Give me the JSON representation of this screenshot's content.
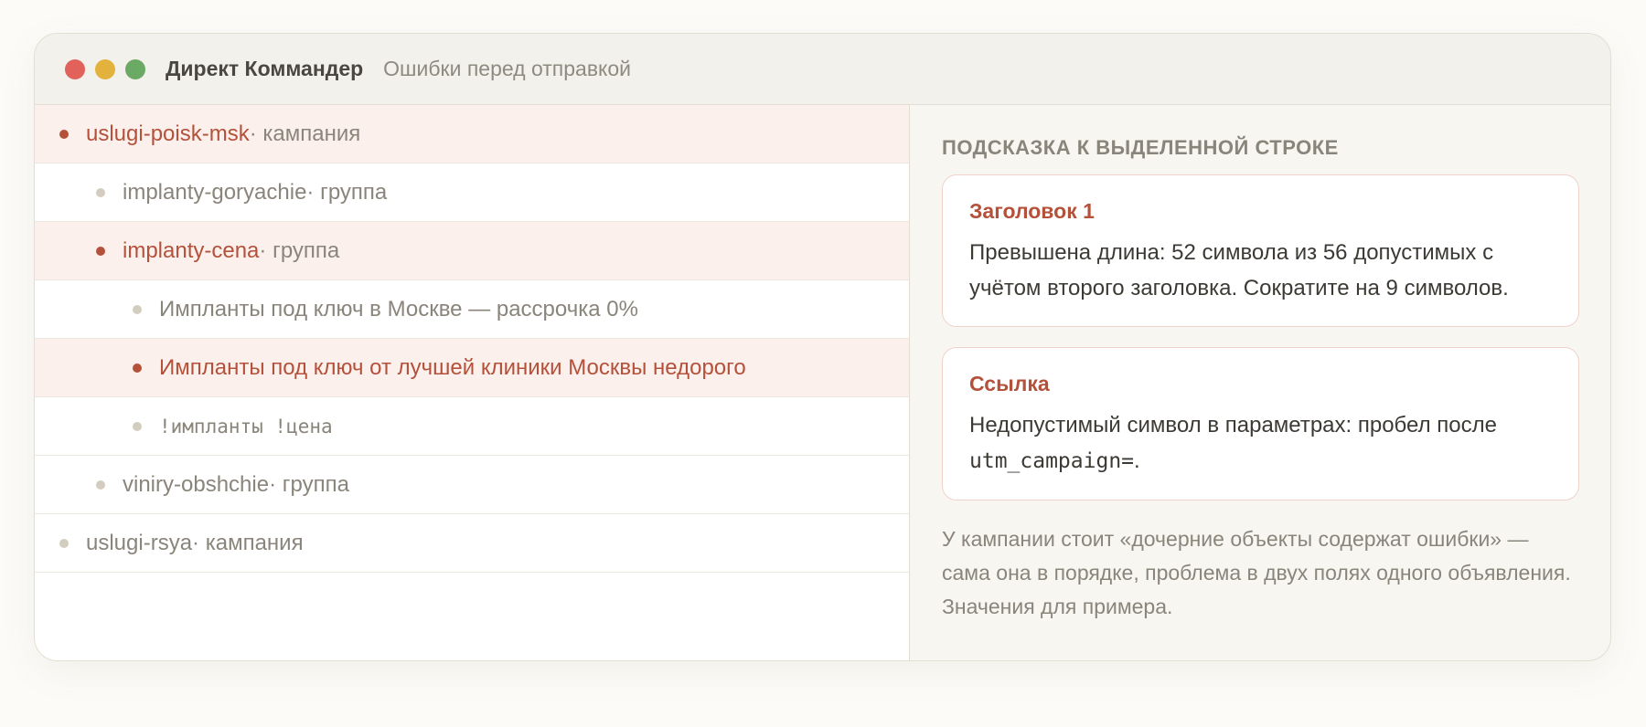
{
  "window": {
    "title": "Директ Коммандер",
    "subtitle": "Ошибки перед отправкой",
    "controls": [
      "close",
      "minimize",
      "maximize"
    ]
  },
  "tree": {
    "rows": [
      {
        "name": "uslugi-poisk-msk",
        "kind": " · кампания",
        "error": true,
        "level": 0
      },
      {
        "name": "implanty-goryachie",
        "kind": " · группа",
        "error": false,
        "level": 1
      },
      {
        "name": "implanty-cena",
        "kind": " · группа",
        "error": true,
        "level": 1
      },
      {
        "name": "Импланты под ключ в Москве — рассрочка 0%",
        "kind": "",
        "error": false,
        "level": 2
      },
      {
        "name": "Импланты под ключ от лучшей клиники Москвы недорого",
        "kind": "",
        "error": true,
        "level": 2
      },
      {
        "name": "!импланты !цена",
        "kind": "",
        "error": false,
        "level": 2,
        "mono": true
      },
      {
        "name": "viniry-obshchie",
        "kind": " · группа",
        "error": false,
        "level": 1
      },
      {
        "name": "uslugi-rsya",
        "kind": " · кампания",
        "error": false,
        "level": 0
      }
    ]
  },
  "hint": {
    "heading": "ПОДСКАЗКА К ВЫДЕЛЕННОЙ СТРОКЕ",
    "cards": [
      {
        "title": "Заголовок 1",
        "text": "Превышена длина: 52 символа из 56 допустимых с учётом второго заголовка. Сократите на 9 символов."
      },
      {
        "title": "Ссылка",
        "text_before": "Недопустимый символ в параметрах: пробел после ",
        "code": "utm_campaign=",
        "text_after": "."
      }
    ],
    "note": "У кампании стоит «дочерние объекты содержат ошибки» — сама она в порядке, проблема в двух полях одного объявления. Значения для примера."
  },
  "colors": {
    "error": "#b4513a",
    "error_row_bg": "#fcf0ec",
    "muted": "#8a857b",
    "close": "#e0625a",
    "minimize": "#e3b23c",
    "maximize": "#6aaa64"
  }
}
